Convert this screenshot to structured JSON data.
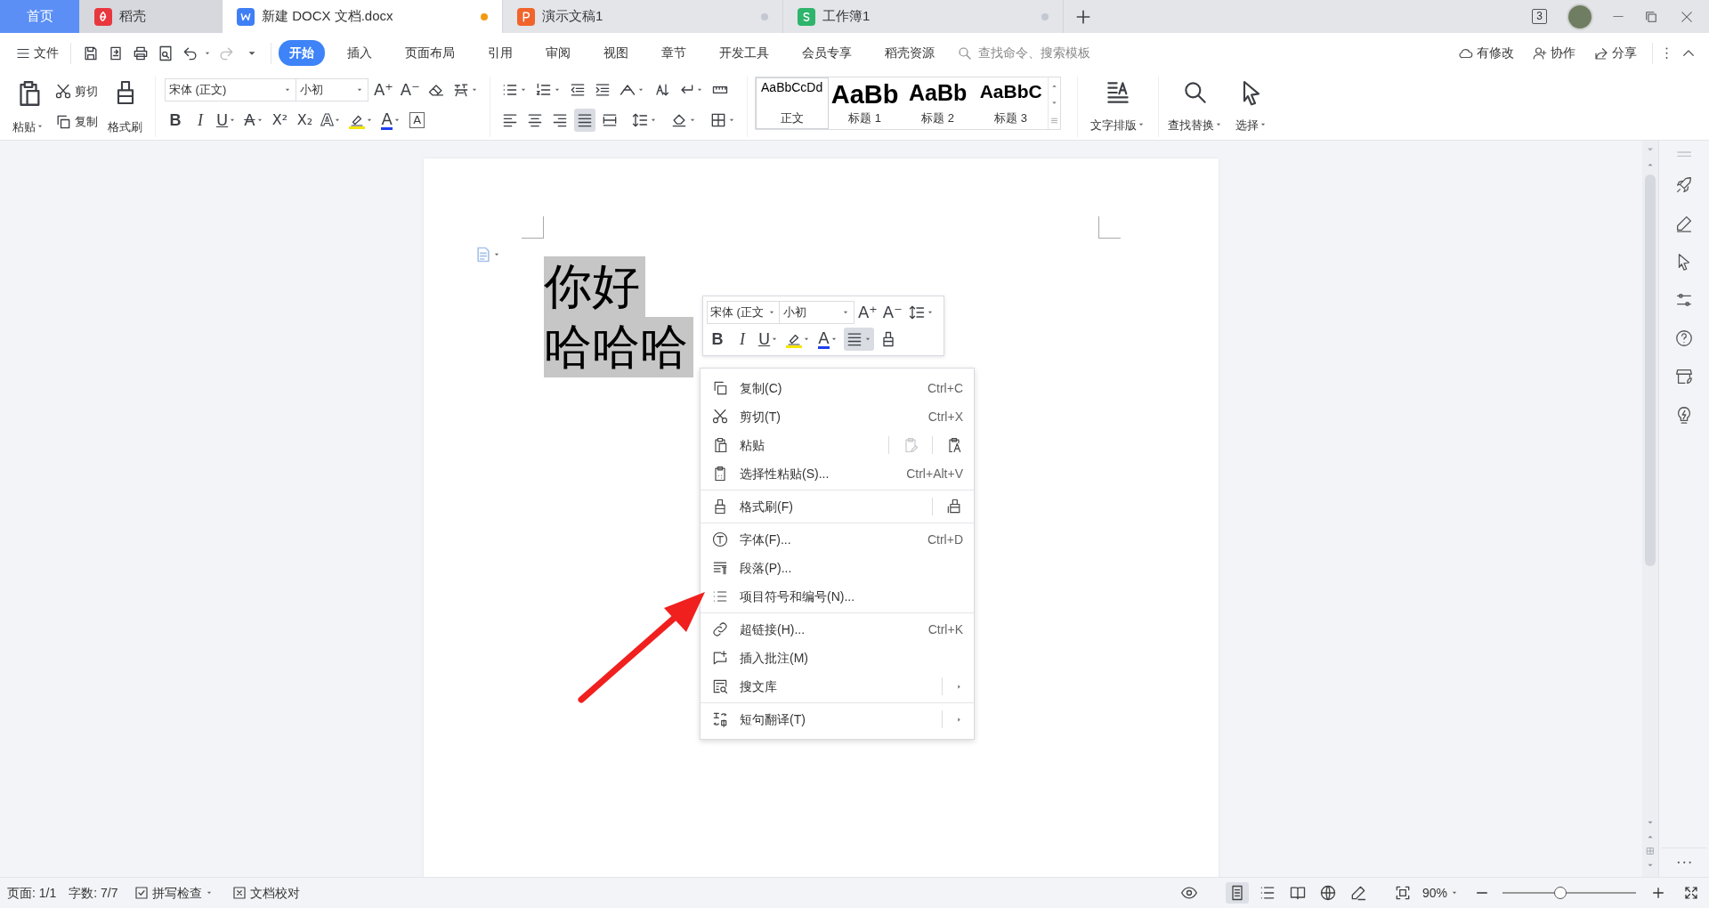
{
  "tabs": [
    {
      "label": "首页",
      "kind": "home",
      "selected": false
    },
    {
      "label": "稻壳",
      "kind": "docer",
      "selected": false
    },
    {
      "label": "新建 DOCX 文档.docx",
      "kind": "writer",
      "selected": true,
      "unsaved": true
    },
    {
      "label": "演示文稿1",
      "kind": "presentation",
      "selected": false,
      "unsaved": false
    },
    {
      "label": "工作簿1",
      "kind": "spreadsheet",
      "selected": false,
      "unsaved": false
    }
  ],
  "window_count": "3",
  "menu": {
    "file": "文件",
    "tabs": [
      {
        "label": "开始",
        "selected": true
      },
      {
        "label": "插入",
        "selected": false
      },
      {
        "label": "页面布局",
        "selected": false
      },
      {
        "label": "引用",
        "selected": false
      },
      {
        "label": "审阅",
        "selected": false
      },
      {
        "label": "视图",
        "selected": false
      },
      {
        "label": "章节",
        "selected": false
      },
      {
        "label": "开发工具",
        "selected": false
      },
      {
        "label": "会员专享",
        "selected": false
      },
      {
        "label": "稻壳资源",
        "selected": false
      }
    ],
    "search": {
      "placeholder": "查找命令、搜索模板"
    },
    "actions": [
      {
        "label": "有修改",
        "kind": "sync"
      },
      {
        "label": "协作",
        "kind": "collab"
      },
      {
        "label": "分享",
        "kind": "share"
      }
    ]
  },
  "ribbon": {
    "paste": "粘贴",
    "cut": "剪切",
    "copy": "复制",
    "format_painter": "格式刷",
    "font": "宋体 (正文)",
    "size": "小初",
    "grow": "A⁺",
    "shrink": "A⁻",
    "font_buttons": [
      {
        "kind": "bold",
        "glyph": "B"
      },
      {
        "kind": "italic",
        "glyph": "I"
      },
      {
        "kind": "underline",
        "glyph": "U"
      },
      {
        "kind": "strike",
        "glyph": "A"
      },
      {
        "kind": "sup",
        "glyph": "X²"
      },
      {
        "kind": "sub",
        "glyph": "X₂"
      },
      {
        "kind": "effect",
        "glyph": "A"
      },
      {
        "kind": "highlight"
      },
      {
        "kind": "font-color",
        "glyph": "A"
      },
      {
        "kind": "char-border",
        "glyph": "A"
      }
    ],
    "aligns": [
      {
        "kind": "left",
        "active": false
      },
      {
        "kind": "center",
        "active": false
      },
      {
        "kind": "right",
        "active": false
      },
      {
        "kind": "justify",
        "active": true
      },
      {
        "kind": "distributed",
        "active": false
      }
    ],
    "styles": [
      {
        "preview": "AaBbCcDd",
        "label": "正文",
        "kind": "body",
        "selected": true
      },
      {
        "preview": "AaBb",
        "label": "标题 1",
        "kind": "h1",
        "selected": false
      },
      {
        "preview": "AaBb",
        "label": "标题 2",
        "kind": "h2",
        "selected": false
      },
      {
        "preview": "AaBbC",
        "label": "标题 3",
        "kind": "h3",
        "selected": false
      }
    ],
    "text_layout": "文字排版",
    "find_replace": "查找替换",
    "select": "选择"
  },
  "document": {
    "lines": [
      "你好",
      "哈哈哈"
    ]
  },
  "mini_toolbar": {
    "font": "宋体 (正文",
    "size": "小初",
    "grow": "A⁺",
    "shrink": "A⁻",
    "buttons": [
      {
        "kind": "bold",
        "glyph": "B",
        "active": false
      },
      {
        "kind": "italic",
        "glyph": "I",
        "active": false
      },
      {
        "kind": "underline",
        "glyph": "U",
        "active": false
      },
      {
        "kind": "highlight",
        "active": false
      },
      {
        "kind": "font-color",
        "glyph": "A",
        "active": false
      },
      {
        "kind": "align",
        "active": true
      },
      {
        "kind": "painter",
        "active": false
      }
    ]
  },
  "context_menu": {
    "groups": [
      [
        {
          "label": "复制(C)",
          "shortcut": "Ctrl+C",
          "kind": "copy",
          "submenu": false
        },
        {
          "label": "剪切(T)",
          "shortcut": "Ctrl+X",
          "kind": "cut",
          "submenu": false
        },
        {
          "label": "粘贴",
          "kind": "paste",
          "submenu": false,
          "extras": [
            {
              "kind": "paste-edit",
              "disabled": true
            },
            {
              "kind": "paste-text",
              "disabled": false
            }
          ]
        },
        {
          "label": "选择性粘贴(S)...",
          "shortcut": "Ctrl+Alt+V",
          "kind": "paste-special",
          "submenu": false
        }
      ],
      [
        {
          "label": "格式刷(F)",
          "kind": "painter",
          "submenu": false,
          "extras": [
            {
              "kind": "painter-multi",
              "disabled": false
            }
          ]
        }
      ],
      [
        {
          "label": "字体(F)...",
          "shortcut": "Ctrl+D",
          "kind": "font",
          "submenu": false
        },
        {
          "label": "段落(P)...",
          "kind": "paragraph",
          "submenu": false
        },
        {
          "label": "项目符号和编号(N)...",
          "kind": "bullets",
          "submenu": false
        }
      ],
      [
        {
          "label": "超链接(H)...",
          "shortcut": "Ctrl+K",
          "kind": "link",
          "submenu": false
        },
        {
          "label": "插入批注(M)",
          "kind": "comment",
          "submenu": false
        },
        {
          "label": "搜文库",
          "kind": "library",
          "submenu": true
        }
      ],
      [
        {
          "label": "短句翻译(T)",
          "kind": "translate",
          "submenu": true
        }
      ]
    ]
  },
  "status_bar": {
    "page": "页面: 1/1",
    "words": "字数: 7/7",
    "spell": "拼写检查",
    "proof": "文档校对",
    "views": [
      {
        "kind": "page",
        "selected": true
      },
      {
        "kind": "outline",
        "selected": false
      },
      {
        "kind": "read",
        "selected": false
      },
      {
        "kind": "web",
        "selected": false
      },
      {
        "kind": "write",
        "selected": false
      }
    ],
    "zoom": "90%",
    "zoom_slider": {
      "level": 0.43
    }
  }
}
